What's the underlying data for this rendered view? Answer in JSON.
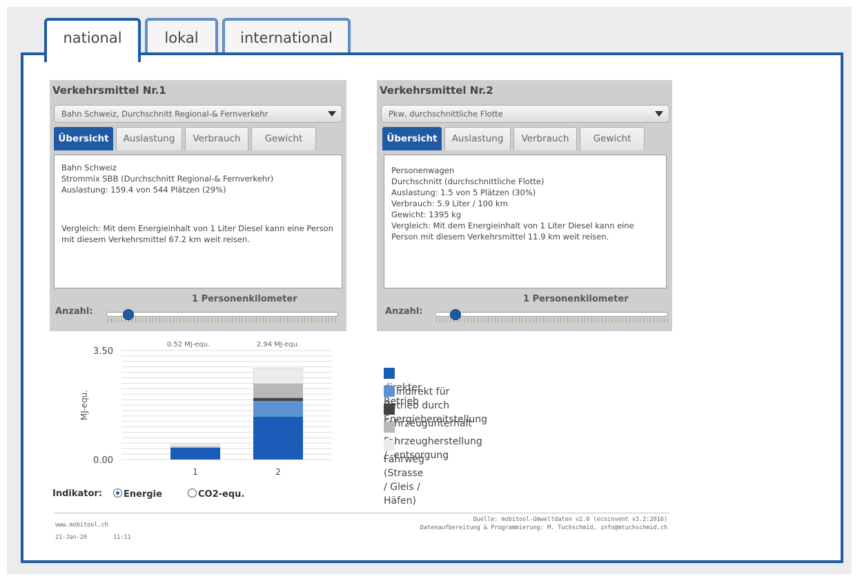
{
  "tabs": [
    {
      "label": "national",
      "active": true
    },
    {
      "label": "lokal",
      "active": false
    },
    {
      "label": "international",
      "active": false
    }
  ],
  "vm1": {
    "title": "Verkehrsmittel Nr.1",
    "select": "Bahn Schweiz, Durchschnitt Regional-& Fernverkehr",
    "subtabs": [
      "Übersicht",
      "Auslastung",
      "Verbrauch",
      "Gewicht"
    ],
    "lines": [
      "Bahn Schweiz",
      "Strommix SBB (Durchschnitt Regional-& Fernverkehr)",
      "Auslastung:  159.4 von 544 Plätzen (29%)"
    ],
    "comparison": "Vergleich: Mit dem Energieinhalt von 1 Liter Diesel kann eine Person mit diesem Verkehrsmittel 67.2 km weit reisen.",
    "slider_label": "Anzahl:",
    "slider_caption": "1 Personenkilometer"
  },
  "vm2": {
    "title": "Verkehrsmittel Nr.2",
    "select": "Pkw, durchschnittliche Flotte",
    "subtabs": [
      "Übersicht",
      "Auslastung",
      "Verbrauch",
      "Gewicht"
    ],
    "lines": [
      "Personenwagen",
      "Durchschnitt (durchschnittliche Flotte)",
      "Auslastung:   1.5 von 5 Plätzen (30%)",
      "Verbrauch:   5.9  Liter / 100 km",
      "Gewicht:      1395 kg"
    ],
    "comparison": "Vergleich: Mit dem Energieinhalt von 1 Liter Diesel kann eine Person mit diesem Verkehrsmittel 11.9 km weit reisen.",
    "slider_label": "Anzahl:",
    "slider_caption": "1 Personenkilometer"
  },
  "chart_data": {
    "type": "bar",
    "stacked": true,
    "categories": [
      "1",
      "2"
    ],
    "ylabel": "MJ-equ.",
    "ylim": [
      0,
      3.5
    ],
    "ytick_labels": [
      "3.50",
      "0.00"
    ],
    "totals_labels": [
      "0.52 MJ-equ.",
      "2.94 MJ-equ."
    ],
    "series": [
      {
        "name": "direkter Betrieb",
        "color": "#1a5cb8",
        "values": [
          0.38,
          1.38
        ]
      },
      {
        "name": "indirekt für Betrieb durch Energiebereitstellung",
        "color": "#5b93d2",
        "values": [
          0.0,
          0.5
        ]
      },
      {
        "name": "Fahrzeugunterhalt",
        "color": "#444444",
        "values": [
          0.0,
          0.1
        ]
      },
      {
        "name": "Fahrzeugherstellung /  -entsorgung",
        "color": "#b8b8b8",
        "values": [
          0.04,
          0.46
        ]
      },
      {
        "name": "Fahrweg  (Strasse / Gleis / Häfen)",
        "color": "#ebebeb",
        "values": [
          0.1,
          0.5
        ]
      }
    ]
  },
  "indikator": {
    "label": "Indikator:",
    "options": [
      {
        "label": "Energie",
        "selected": true
      },
      {
        "label": "CO2-equ.",
        "selected": false
      }
    ]
  },
  "footer": {
    "site": "www.mobitool.ch",
    "date": "21-Jan-20",
    "time": "11:11",
    "source": "Quelle: mobitool-Umweltdaten v2.0 (ecoinvent v3.2:2016)",
    "credits": "Datenaufbereitung & Programmierung: M. Tuchschmid, info@mtuchschmid.ch"
  }
}
